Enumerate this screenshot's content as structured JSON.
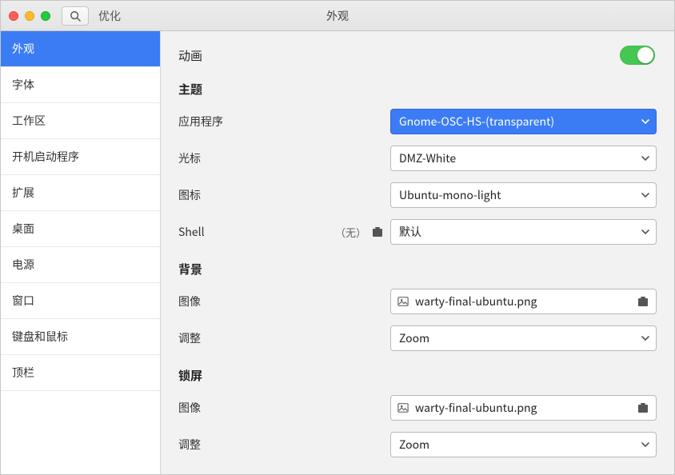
{
  "titlebar": {
    "appName": "优化",
    "pageTitle": "外观"
  },
  "sidebar": {
    "items": [
      {
        "label": "外观",
        "active": true
      },
      {
        "label": "字体"
      },
      {
        "label": "工作区"
      },
      {
        "label": "开机启动程序"
      },
      {
        "label": "扩展"
      },
      {
        "label": "桌面"
      },
      {
        "label": "电源"
      },
      {
        "label": "窗口"
      },
      {
        "label": "键盘和鼠标"
      },
      {
        "label": "顶栏"
      }
    ]
  },
  "main": {
    "animation": {
      "label": "动画",
      "value": true
    },
    "theme": {
      "heading": "主题",
      "app": {
        "label": "应用程序",
        "value": "Gnome-OSC-HS-(transparent)"
      },
      "cursor": {
        "label": "光标",
        "value": "DMZ-White"
      },
      "icons": {
        "label": "图标",
        "value": "Ubuntu-mono-light"
      },
      "shell": {
        "label": "Shell",
        "none": "（无）",
        "value": "默认"
      }
    },
    "background": {
      "heading": "背景",
      "image": {
        "label": "图像",
        "value": "warty-final-ubuntu.png"
      },
      "adjust": {
        "label": "调整",
        "value": "Zoom"
      }
    },
    "lockscreen": {
      "heading": "锁屏",
      "image": {
        "label": "图像",
        "value": "warty-final-ubuntu.png"
      },
      "adjust": {
        "label": "调整",
        "value": "Zoom"
      }
    }
  }
}
